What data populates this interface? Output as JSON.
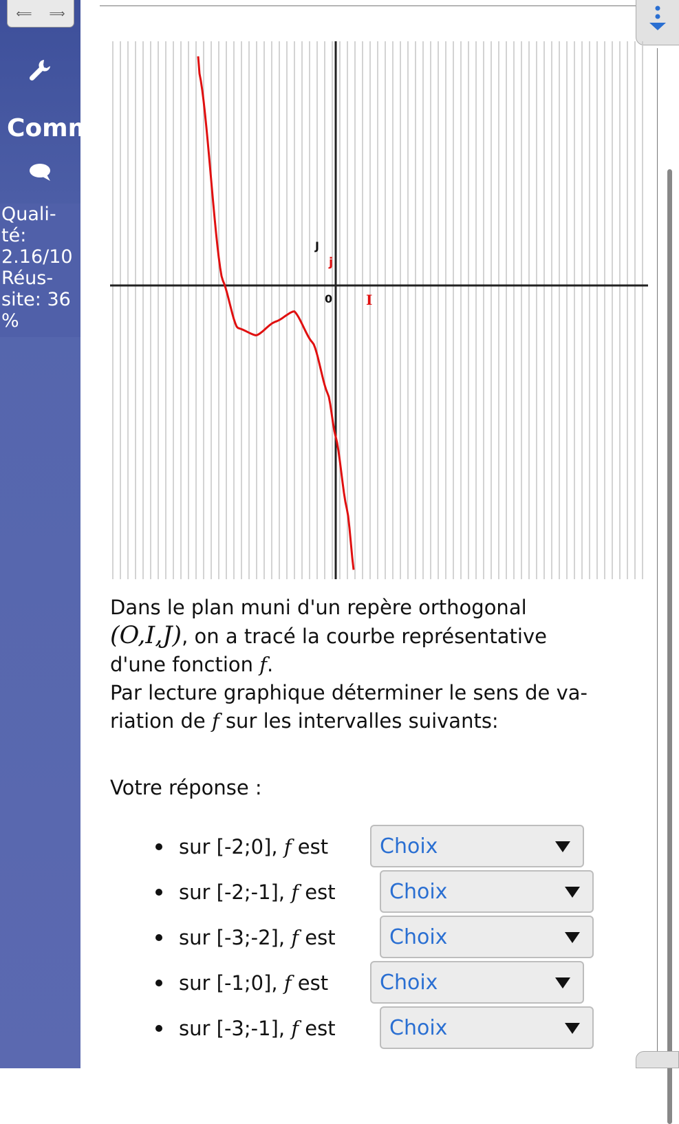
{
  "sidebar": {
    "section_title": "Comm",
    "stats": {
      "quality_label": "Quali-",
      "quality_label2": "té:",
      "quality_value": "2.16/10",
      "success_label": "Réus-",
      "success_label2": "site: 36",
      "success_unit": "%"
    }
  },
  "graph": {
    "origin_label": "0",
    "i_label": "I",
    "j_label": "J",
    "j_vec_label": "j"
  },
  "statement": {
    "line1": "Dans le plan muni d'un repère orthogonal",
    "frame": "(O,I,J)",
    "line2": ", on a tracé la courbe représentative",
    "line3": "d'une fonction",
    "fname": "f",
    "line3_end": ".",
    "line4": "Par lecture graphique déterminer le sens de va-",
    "line5a": "riation de",
    "line5b": "sur les intervalles suivants:"
  },
  "answer": {
    "label": "Votre réponse :",
    "items": [
      {
        "prefix": "sur",
        "interval": "[-2;0],",
        "fname": "f",
        "suffix": "est",
        "choice": "Choix"
      },
      {
        "prefix": "sur",
        "interval": "[-2;-1],",
        "fname": "f",
        "suffix": "est",
        "choice": "Choix"
      },
      {
        "prefix": "sur",
        "interval": "[-3;-2],",
        "fname": "f",
        "suffix": "est",
        "choice": "Choix"
      },
      {
        "prefix": "sur",
        "interval": "[-1;0],",
        "fname": "f",
        "suffix": "est",
        "choice": "Choix"
      },
      {
        "prefix": "sur",
        "interval": "[-3;-1],",
        "fname": "f",
        "suffix": "est",
        "choice": "Choix"
      }
    ]
  },
  "colors": {
    "sidebar": "#5b69b0",
    "curve": "#e01010",
    "select_text": "#2a6fd2"
  }
}
